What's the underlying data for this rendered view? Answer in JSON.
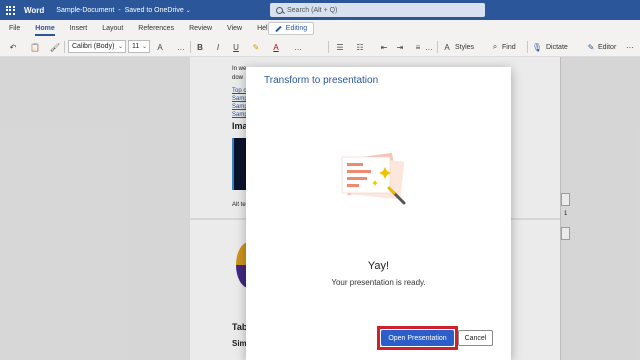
{
  "titlebar": {
    "app_name": "Word",
    "doc_name": "Sample-Document",
    "separator": "-",
    "save_status": "Saved to OneDrive",
    "chevron": "⌄",
    "search_placeholder": "Search (Alt + Q)",
    "bg_color": "#2b579a"
  },
  "menu": {
    "tabs": [
      "File",
      "Home",
      "Insert",
      "Layout",
      "References",
      "Review",
      "View",
      "Help"
    ],
    "active_tab": "Home",
    "editing_label": "Editing"
  },
  "ribbon": {
    "undo": "↶",
    "paste": "📋",
    "format_painter": "🖌",
    "font_name": "Calibri (Body)",
    "font_size": "11",
    "grow_font": "A",
    "bold": "B",
    "italic": "I",
    "underline": "U",
    "more": "…",
    "highlight": "✎",
    "font_color": "A",
    "bullets": "☰",
    "numbering": "☷",
    "outdent": "⇤",
    "indent": "⇥",
    "align": "≡",
    "styles_label": "Styles",
    "find_label": "Find",
    "dictate_label": "Dictate",
    "editor_label": "Editor",
    "overflow": "⋯"
  },
  "document": {
    "line1": "In we",
    "line2": "dow",
    "link1": "Top o",
    "link2": "Samp",
    "link3": "Samp",
    "link4": "Samp",
    "heading_image": "Ima",
    "alt_text": "Alt te",
    "heading_table": "Tab",
    "heading_simple": "Sim",
    "margin_mark": "1"
  },
  "dialog": {
    "title": "Transform to presentation",
    "heading": "Yay!",
    "message": "Your presentation is ready.",
    "open_button": "Open Presentation",
    "cancel_button": "Cancel",
    "accent_color": "#2b579a",
    "primary_button_color": "#2b5ec9",
    "highlight_color": "#d0202a"
  }
}
